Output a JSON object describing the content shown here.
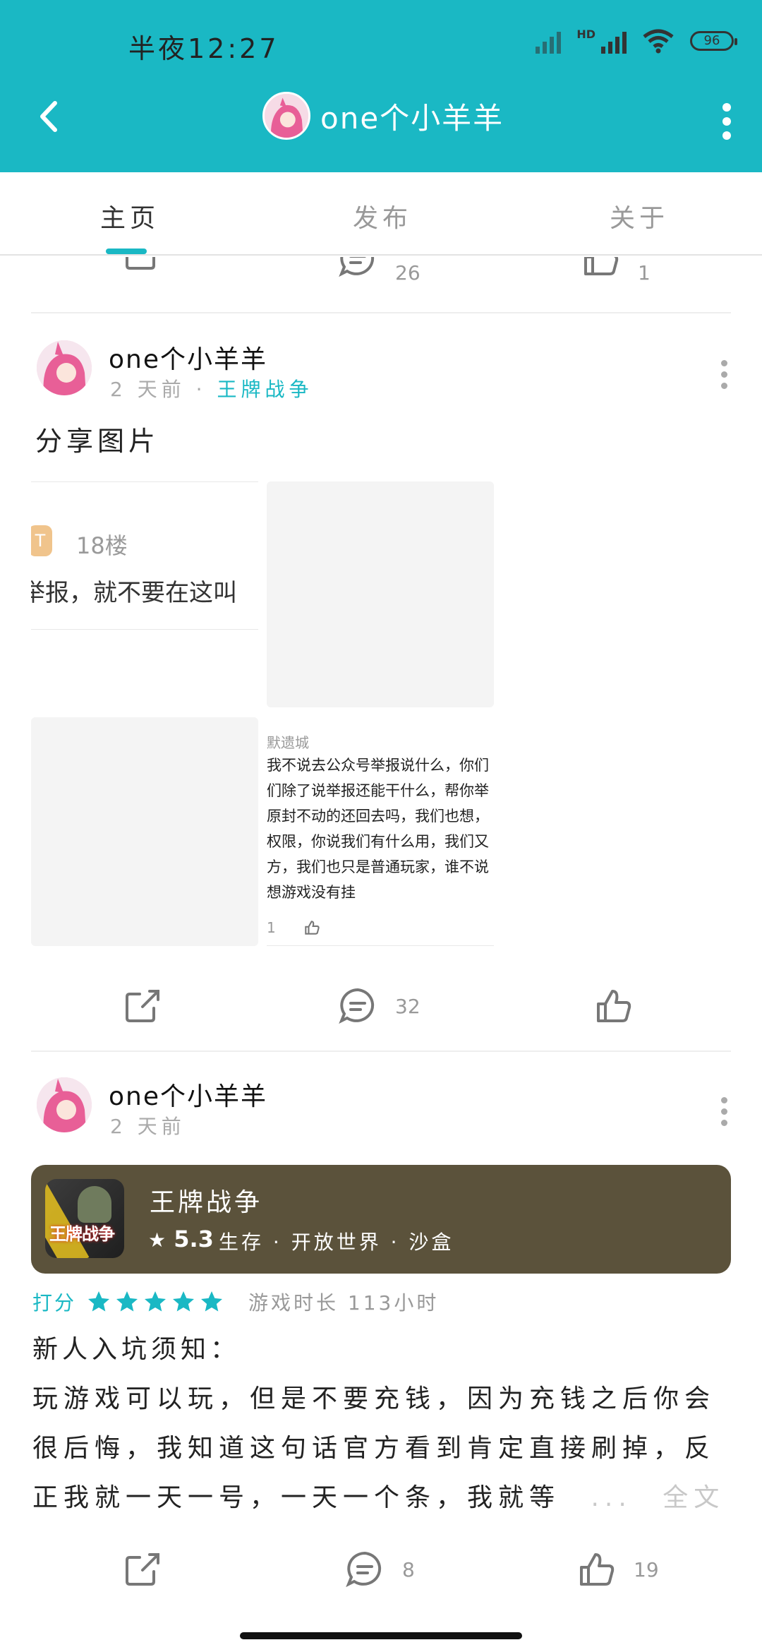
{
  "status_bar": {
    "time": "半夜12:27",
    "network": "HD",
    "battery": "96"
  },
  "nav": {
    "title": "one个小羊羊"
  },
  "tabs": [
    {
      "label": "主页"
    },
    {
      "label": "发布"
    },
    {
      "label": "关于"
    }
  ],
  "partial_actions": {
    "comments": "26",
    "likes": "1"
  },
  "post1": {
    "author": "one个小羊羊",
    "time": "2 天前",
    "separator": "·",
    "game": "王牌战争",
    "text": "分享图片",
    "screenshot": {
      "floor_badge": "T",
      "floor": "18楼",
      "report_line": "举报，就不要在这叫",
      "comment_user": "默遗城",
      "comment_lines": [
        "我不说去公众号举报说什么，你们",
        "们除了说举报还能干什么，帮你举",
        "原封不动的还回去吗，我们也想，",
        "权限，你说我们有什么用，我们又",
        "方，我们也只是普通玩家，谁不说",
        "想游戏没有挂"
      ],
      "comment_count": "1"
    },
    "actions": {
      "comments": "32",
      "likes": ""
    }
  },
  "post2": {
    "author": "one个小羊羊",
    "time": "2 天前",
    "game_card": {
      "icon_text": "王牌战争",
      "name": "王牌战争",
      "score": "5.3",
      "tags": "生存 · 开放世界 · 沙盒"
    },
    "rating_label": "打分",
    "rating_stars": 5,
    "playtime": "游戏时长 113小时",
    "review_heading": "新人入坑须知：",
    "review_lines": [
      "玩游戏可以玩，但是不要充钱，因为充钱之后你会",
      "很后悔，我知道这句话官方看到肯定直接刷掉，反",
      "正我就一天一号，一天一个条，我就等"
    ],
    "ellipsis": "...",
    "full_text": "全文",
    "actions": {
      "comments": "8",
      "likes": "19"
    }
  },
  "colors": {
    "accent": "#1ab8c4",
    "game_card": "#5b523b"
  }
}
